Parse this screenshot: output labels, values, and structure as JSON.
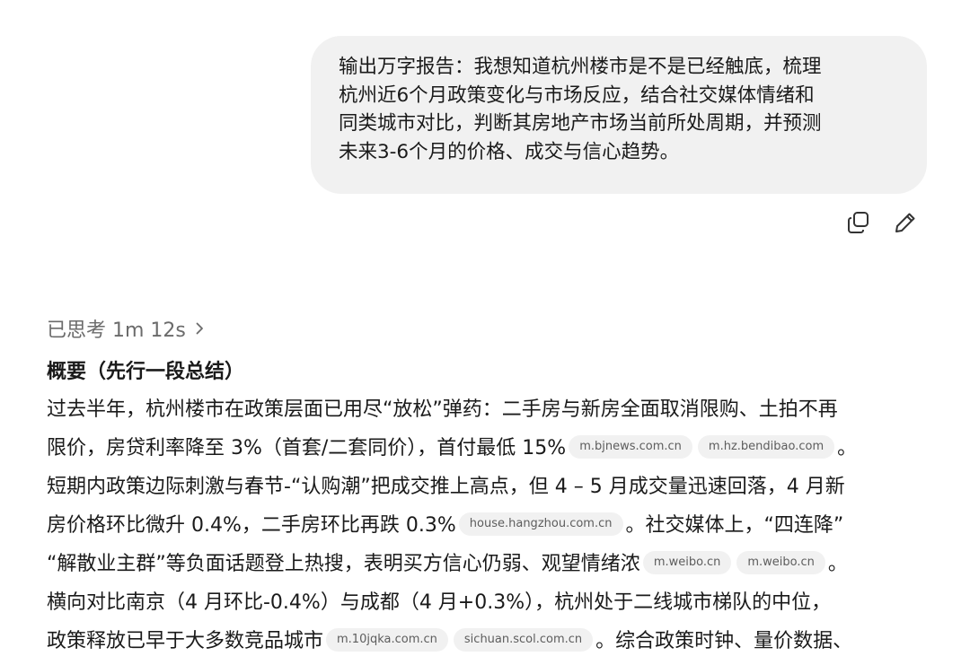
{
  "user_message": {
    "lines": [
      "输出万字报告：我想知道杭州楼市是不是已经触底，梳理",
      "杭州近6个月政策变化与市场反应，结合社交媒体情绪和",
      "同类城市对比，判断其房地产市场当前所处周期，并预测",
      "未来3-6个月的价格、成交与信心趋势。"
    ]
  },
  "actions": {
    "copy_icon": "copy-icon",
    "edit_icon": "pencil-icon"
  },
  "thought": {
    "label": "已思考 1m 12s",
    "chevron_icon": "chevron-right-icon"
  },
  "answer": {
    "heading": "概要（先行一段总结）",
    "lines": [
      {
        "segments": [
          {
            "t": "过去半年，杭州楼市在政策层面已用尽“放松”弹药：二手房与新房全面取消限购、土拍不再"
          }
        ]
      },
      {
        "segments": [
          {
            "t": "限价，房贷利率降至 3%（首套/二套同价），首付最低 15%"
          },
          {
            "chip": "m.bjnews.com.cn"
          },
          {
            "chip": "m.hz.bendibao.com"
          },
          {
            "t": "。"
          }
        ]
      },
      {
        "segments": [
          {
            "t": "短期内政策边际刺激与春节-“认购潮”把成交推上高点，但 4 – 5 月成交量迅速回落，4 月新"
          }
        ]
      },
      {
        "segments": [
          {
            "t": "房价格环比微升 0.4%，二手房环比再跌 0.3%"
          },
          {
            "chip": "house.hangzhou.com.cn"
          },
          {
            "t": "。社交媒体上，“四连降”"
          }
        ]
      },
      {
        "segments": [
          {
            "t": "“解散业主群”等负面话题登上热搜，表明买方信心仍弱、观望情绪浓"
          },
          {
            "chip": "m.weibo.cn"
          },
          {
            "chip": "m.weibo.cn"
          },
          {
            "t": "。"
          }
        ]
      },
      {
        "segments": [
          {
            "t": "横向对比南京（4 月环比-0.4%）与成都（4 月+0.3%），杭州处于二线城市梯队的中位，"
          }
        ]
      },
      {
        "segments": [
          {
            "t": "政策释放已早于大多数竞品城市"
          },
          {
            "chip": "m.10jqka.com.cn"
          },
          {
            "chip": "sichuan.scol.com.cn"
          },
          {
            "t": "。综合政策时钟、量价数据、"
          }
        ]
      }
    ]
  }
}
